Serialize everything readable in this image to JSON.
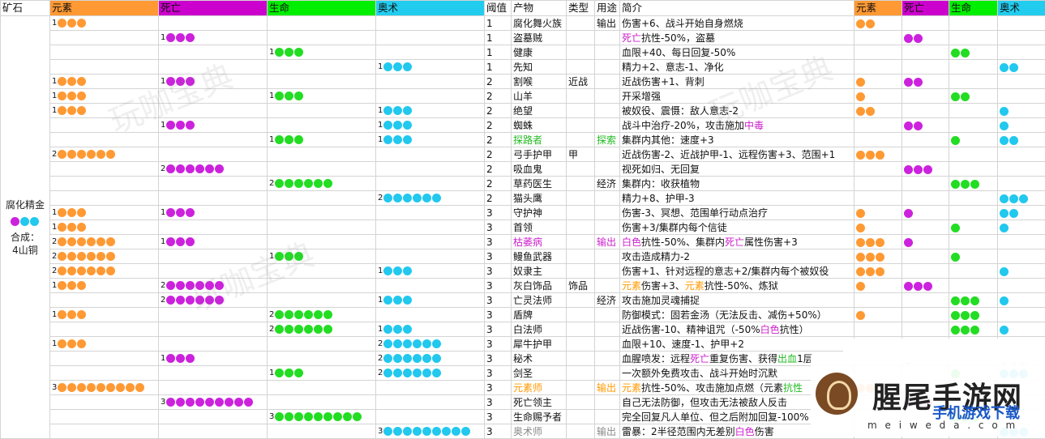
{
  "headers": {
    "ore": "矿石",
    "element": "元素",
    "death": "死亡",
    "life": "生命",
    "arcane": "奥术",
    "threshold": "阈值",
    "product": "产物",
    "type": "类型",
    "use": "用途",
    "desc": "简介",
    "r_element": "元素",
    "r_death": "死亡",
    "r_life": "生命",
    "r_arcane": "奥术"
  },
  "ore": {
    "name": "腐化精金",
    "dots": [
      "m",
      "b",
      "b"
    ],
    "combine_label": "合成：",
    "combine_value": "4山铜"
  },
  "watermark": "玩咖宝典",
  "logo": {
    "main": "腥尾手游网",
    "sub": "m e i w e d a . c o m",
    "blue": "手机游戏下载"
  },
  "rows": [
    {
      "e": 1,
      "d": 0,
      "l": 0,
      "a": 0,
      "th": "1",
      "p": "腐化舞火族",
      "pc": "",
      "ty": "",
      "u": "输出",
      "uc": "",
      "ds": [
        [
          "伤害+6、战斗开始自身燃烧",
          ""
        ]
      ],
      "re": 2,
      "rd": 0,
      "rl": 0,
      "ra": 0
    },
    {
      "e": 0,
      "d": 1,
      "l": 0,
      "a": 0,
      "th": "1",
      "p": "盗墓贼",
      "pc": "",
      "ty": "",
      "u": "",
      "uc": "",
      "ds": [
        [
          "死亡",
          "purple"
        ],
        [
          "抗性-50%，盗墓",
          ""
        ]
      ],
      "re": 0,
      "rd": 2,
      "rl": 0,
      "ra": 0
    },
    {
      "e": 0,
      "d": 0,
      "l": 1,
      "a": 0,
      "th": "1",
      "p": "健康",
      "pc": "",
      "ty": "",
      "u": "",
      "uc": "",
      "ds": [
        [
          "血限+40、每日回复-50%",
          ""
        ]
      ],
      "re": 0,
      "rd": 0,
      "rl": 2,
      "ra": 0
    },
    {
      "e": 0,
      "d": 0,
      "l": 0,
      "a": 1,
      "th": "1",
      "p": "先知",
      "pc": "",
      "ty": "",
      "u": "",
      "uc": "",
      "ds": [
        [
          "精力+2、意志-1、净化",
          ""
        ]
      ],
      "re": 0,
      "rd": 0,
      "rl": 0,
      "ra": 2
    },
    {
      "e": 1,
      "d": 1,
      "l": 0,
      "a": 0,
      "th": "2",
      "p": "割喉",
      "pc": "",
      "ty": "近战",
      "u": "",
      "uc": "",
      "ds": [
        [
          "近战伤害+1、背刺",
          ""
        ]
      ],
      "re": 1,
      "rd": 2,
      "rl": 0,
      "ra": 0
    },
    {
      "e": 1,
      "d": 0,
      "l": 1,
      "a": 0,
      "th": "2",
      "p": "山羊",
      "pc": "",
      "ty": "",
      "u": "",
      "uc": "",
      "ds": [
        [
          "开采增强",
          ""
        ]
      ],
      "re": 1,
      "rd": 0,
      "rl": 2,
      "ra": 0
    },
    {
      "e": 1,
      "d": 0,
      "l": 0,
      "a": 1,
      "th": "2",
      "p": "绝望",
      "pc": "",
      "ty": "",
      "u": "",
      "uc": "",
      "ds": [
        [
          "被奴役、震慑：敌人意志-2",
          ""
        ]
      ],
      "re": 2,
      "rd": 0,
      "rl": 0,
      "ra": 1
    },
    {
      "e": 0,
      "d": 1,
      "l": 0,
      "a": 1,
      "th": "2",
      "p": "蜘蛛",
      "pc": "",
      "ty": "",
      "u": "",
      "uc": "",
      "ds": [
        [
          "战斗中治疗-20%，攻击施加",
          ""
        ],
        [
          "中毒",
          "purple"
        ]
      ],
      "re": 0,
      "rd": 2,
      "rl": 0,
      "ra": 1
    },
    {
      "e": 0,
      "d": 0,
      "l": 1,
      "a": 1,
      "th": "2",
      "p": "探路者",
      "pc": "green",
      "ty": "",
      "u": "探索",
      "uc": "green",
      "ds": [
        [
          "集群内其他：速度+3",
          ""
        ]
      ],
      "re": 0,
      "rd": 0,
      "rl": 1,
      "ra": 2
    },
    {
      "e": 2,
      "d": 0,
      "l": 0,
      "a": 0,
      "th": "2",
      "p": "弓手护甲",
      "pc": "",
      "ty": "甲",
      "u": "",
      "uc": "",
      "ds": [
        [
          "近战伤害-2、近战护甲-1、远程伤害+3、范围+1",
          ""
        ]
      ],
      "re": 3,
      "rd": 0,
      "rl": 0,
      "ra": 0
    },
    {
      "e": 0,
      "d": 2,
      "l": 0,
      "a": 0,
      "th": "2",
      "p": "吸血鬼",
      "pc": "",
      "ty": "",
      "u": "",
      "uc": "",
      "ds": [
        [
          "视死如归、无回复",
          ""
        ]
      ],
      "re": 0,
      "rd": 3,
      "rl": 0,
      "ra": 0
    },
    {
      "e": 0,
      "d": 0,
      "l": 2,
      "a": 0,
      "th": "2",
      "p": "草药医生",
      "pc": "",
      "ty": "",
      "u": "经济",
      "uc": "",
      "ds": [
        [
          "集群内：收获植物",
          ""
        ]
      ],
      "re": 0,
      "rd": 0,
      "rl": 3,
      "ra": 0
    },
    {
      "e": 0,
      "d": 0,
      "l": 0,
      "a": 2,
      "th": "2",
      "p": "猫头鹰",
      "pc": "",
      "ty": "",
      "u": "",
      "uc": "",
      "ds": [
        [
          "精力+8、护甲-3",
          ""
        ]
      ],
      "re": 0,
      "rd": 0,
      "rl": 0,
      "ra": 3
    },
    {
      "e": 1,
      "d": 1,
      "l": 0,
      "a": 0,
      "th": "3",
      "p": "守护神",
      "pc": "",
      "ty": "",
      "u": "",
      "uc": "",
      "ds": [
        [
          "伤害-3、冥想、范围单行动点治疗",
          ""
        ]
      ],
      "re": 1,
      "rd": 1,
      "rl": 0,
      "ra": 2
    },
    {
      "e": 1,
      "d": 0,
      "l": 0,
      "a": 0,
      "th": "3",
      "p": "首领",
      "pc": "",
      "ty": "",
      "u": "",
      "uc": "",
      "ds": [
        [
          "伤害+3/集群内每个信徒",
          ""
        ]
      ],
      "re": 1,
      "rd": 0,
      "rl": 1,
      "ra": 1
    },
    {
      "e": 2,
      "d": 1,
      "l": 0,
      "a": 0,
      "th": "3",
      "p": "枯萎病",
      "pc": "purple",
      "ty": "",
      "u": "输出",
      "uc": "purple",
      "ds": [
        [
          "白色",
          "purple"
        ],
        [
          "抗性-50%、集群内",
          ""
        ],
        [
          "死亡",
          "purple"
        ],
        [
          "属性伤害+3",
          ""
        ]
      ],
      "re": 3,
      "rd": 1,
      "rl": 0,
      "ra": 0
    },
    {
      "e": 2,
      "d": 0,
      "l": 1,
      "a": 0,
      "th": "3",
      "p": "鳗鱼武器",
      "pc": "",
      "ty": "",
      "u": "",
      "uc": "",
      "ds": [
        [
          "攻击造成精力-2",
          ""
        ]
      ],
      "re": 3,
      "rd": 0,
      "rl": 1,
      "ra": 0
    },
    {
      "e": 2,
      "d": 0,
      "l": 0,
      "a": 1,
      "th": "3",
      "p": "奴隶主",
      "pc": "",
      "ty": "",
      "u": "",
      "uc": "",
      "ds": [
        [
          "伤害+1、针对远程的意志+2/集群内每个被奴役",
          ""
        ]
      ],
      "re": 3,
      "rd": 0,
      "rl": 0,
      "ra": 1
    },
    {
      "e": 1,
      "d": 2,
      "l": 0,
      "a": 0,
      "th": "3",
      "p": "灰白饰品",
      "pc": "",
      "ty": "饰品",
      "u": "",
      "uc": "",
      "ds": [
        [
          "元素",
          "orange"
        ],
        [
          "伤害+3、",
          ""
        ],
        [
          "元素",
          "orange"
        ],
        [
          "抗性-50%、炼狱",
          ""
        ]
      ],
      "re": 1,
      "rd": 3,
      "rl": 0,
      "ra": 0
    },
    {
      "e": 0,
      "d": 2,
      "l": 0,
      "a": 1,
      "th": "3",
      "p": "亡灵法师",
      "pc": "",
      "ty": "",
      "u": "经济",
      "uc": "",
      "ds": [
        [
          "攻击施加灵魂捕捉",
          ""
        ]
      ],
      "re": 0,
      "rd": 0,
      "rl": 3,
      "ra": 1
    },
    {
      "e": 1,
      "d": 0,
      "l": 2,
      "a": 0,
      "th": "3",
      "p": "盾牌",
      "pc": "",
      "ty": "",
      "u": "",
      "uc": "",
      "ds": [
        [
          "防御模式：固若金汤（无法反击、减伤+50%）",
          ""
        ]
      ],
      "re": 1,
      "rd": 0,
      "rl": 3,
      "ra": 0
    },
    {
      "e": 0,
      "d": 0,
      "l": 2,
      "a": 1,
      "th": "3",
      "p": "白法师",
      "pc": "",
      "ty": "",
      "u": "",
      "uc": "",
      "ds": [
        [
          "近战伤害-10、精神诅咒（-50%",
          ""
        ],
        [
          "白色",
          "purple"
        ],
        [
          "抗性）",
          ""
        ]
      ],
      "re": 0,
      "rd": 0,
      "rl": 3,
      "ra": 1
    },
    {
      "e": 1,
      "d": 0,
      "l": 0,
      "a": 2,
      "th": "3",
      "p": "犀牛护甲",
      "pc": "",
      "ty": "",
      "u": "",
      "uc": "",
      "ds": [
        [
          "血限+10、速度-1、护甲+2",
          ""
        ]
      ],
      "re": 1,
      "rd": 0,
      "rl": 0,
      "ra": 3
    },
    {
      "e": 0,
      "d": 1,
      "l": 0,
      "a": 2,
      "th": "3",
      "p": "秘术",
      "pc": "",
      "ty": "",
      "u": "",
      "uc": "",
      "ds": [
        [
          "血腥喷发：远程",
          ""
        ],
        [
          "死亡",
          "purple"
        ],
        [
          "重复伤害、获得",
          ""
        ],
        [
          "出血",
          "green"
        ],
        [
          "1层",
          ""
        ]
      ],
      "re": 0,
      "rd": 1,
      "rl": 0,
      "ra": 3
    },
    {
      "e": 0,
      "d": 0,
      "l": 1,
      "a": 2,
      "th": "3",
      "p": "剑圣",
      "pc": "",
      "ty": "",
      "u": "",
      "uc": "",
      "ds": [
        [
          "一次额外免费攻击、战斗开始时沉默",
          ""
        ]
      ],
      "re": 0,
      "rd": 0,
      "rl": 1,
      "ra": 3
    },
    {
      "e": 3,
      "d": 0,
      "l": 0,
      "a": 0,
      "th": "3",
      "p": "元素师",
      "pc": "orange",
      "ty": "",
      "u": "输出",
      "uc": "orange",
      "ds": [
        [
          "元素",
          "orange"
        ],
        [
          "抗性-50%、攻击施加点燃（元素",
          ""
        ],
        [
          "抗性",
          "green"
        ]
      ],
      "re": 3,
      "rd": 0,
      "rl": 0,
      "ra": 0
    },
    {
      "e": 0,
      "d": 3,
      "l": 0,
      "a": 0,
      "th": "3",
      "p": "死亡领主",
      "pc": "",
      "ty": "",
      "u": "",
      "uc": "",
      "ds": [
        [
          "自己无法防御，但攻击无法被敌人反击",
          ""
        ]
      ],
      "re": 0,
      "rd": 3,
      "rl": 0,
      "ra": 0
    },
    {
      "e": 0,
      "d": 0,
      "l": 3,
      "a": 0,
      "th": "3",
      "p": "生命赐予者",
      "pc": "",
      "ty": "",
      "u": "",
      "uc": "",
      "ds": [
        [
          "完全回复凡人单位、但之后附加回复-100%",
          ""
        ]
      ],
      "re": 0,
      "rd": 0,
      "rl": 3,
      "ra": 0
    },
    {
      "e": 0,
      "d": 0,
      "l": 0,
      "a": 3,
      "th": "3",
      "p": "奥术师",
      "pc": "gray",
      "ty": "",
      "u": "输出",
      "uc": "gray",
      "ds": [
        [
          "雷暴：2半径范围内无差别",
          ""
        ],
        [
          "白色",
          "purple"
        ],
        [
          "伤害",
          ""
        ]
      ],
      "re": 0,
      "rd": 0,
      "rl": 0,
      "ra": 3
    }
  ]
}
